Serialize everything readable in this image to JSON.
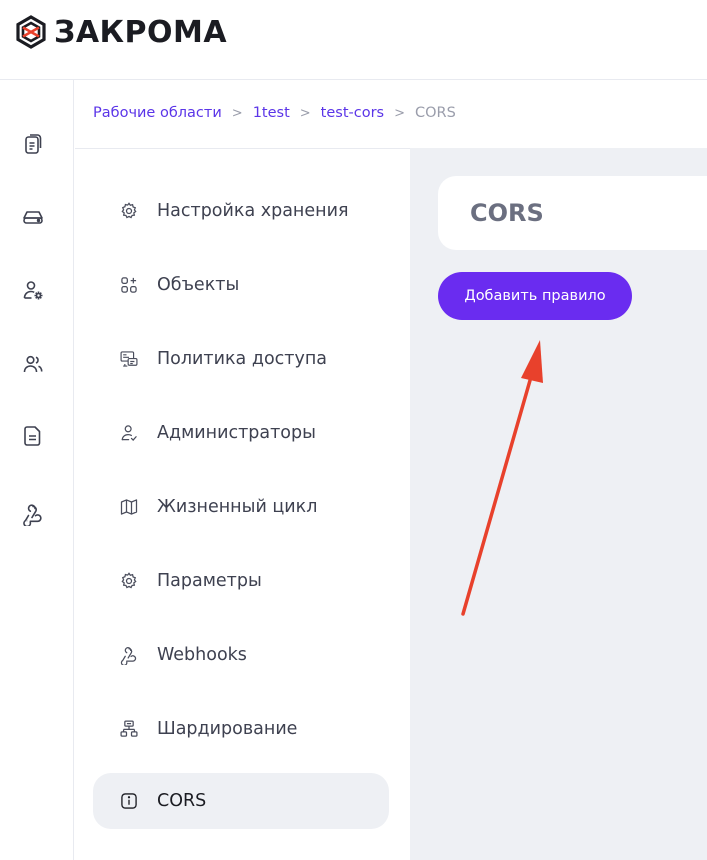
{
  "brand": {
    "name": "ЗАКРОМА",
    "logo_icon": "hexagon-logo-icon"
  },
  "rail": {
    "items": [
      {
        "icon": "documents-icon"
      },
      {
        "icon": "storage-drive-icon"
      },
      {
        "icon": "user-settings-icon"
      },
      {
        "icon": "users-icon"
      },
      {
        "icon": "file-icon"
      },
      {
        "icon": "webhook-icon"
      }
    ]
  },
  "breadcrumb": {
    "items": [
      "Рабочие области",
      "1test",
      "test-cors"
    ],
    "separator": ">",
    "current": "CORS"
  },
  "subnav": {
    "items": [
      {
        "label": "Настройка хранения",
        "icon": "gear-icon"
      },
      {
        "label": "Объекты",
        "icon": "grid-plus-icon"
      },
      {
        "label": "Политика доступа",
        "icon": "access-policy-icon"
      },
      {
        "label": "Администраторы",
        "icon": "admin-user-icon"
      },
      {
        "label": "Жизненный цикл",
        "icon": "map-icon"
      },
      {
        "label": "Параметры",
        "icon": "gear-icon"
      },
      {
        "label": "Webhooks",
        "icon": "webhook-icon"
      },
      {
        "label": "Шардирование",
        "icon": "sharding-icon"
      },
      {
        "label": "CORS",
        "icon": "info-icon",
        "active": true
      }
    ]
  },
  "main": {
    "title": "CORS",
    "add_rule_button": "Добавить правило"
  },
  "colors": {
    "accent": "#6a2cf0",
    "link": "#5b35e8",
    "panel_bg": "#eef0f4",
    "annotation_arrow": "#e8412c"
  }
}
